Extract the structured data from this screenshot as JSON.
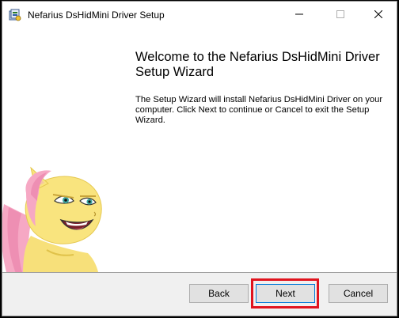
{
  "window": {
    "title": "Nefarius DsHidMini Driver Setup",
    "controls": {
      "minimize_icon": "minimize-icon",
      "maximize_icon": "maximize-icon",
      "close_icon": "close-icon"
    }
  },
  "wizard": {
    "heading": "Welcome to the Nefarius DsHidMini Driver Setup Wizard",
    "body": "The Setup Wizard will install Nefarius DsHidMini Driver on your computer. Click Next to continue or Cancel to exit the Setup Wizard."
  },
  "buttons": {
    "back_label": "Back",
    "next_label": "Next",
    "cancel_label": "Cancel"
  },
  "colors": {
    "highlight": "#e0141e",
    "focus_border": "#0078d7",
    "footer_bg": "#f0f0f0"
  }
}
